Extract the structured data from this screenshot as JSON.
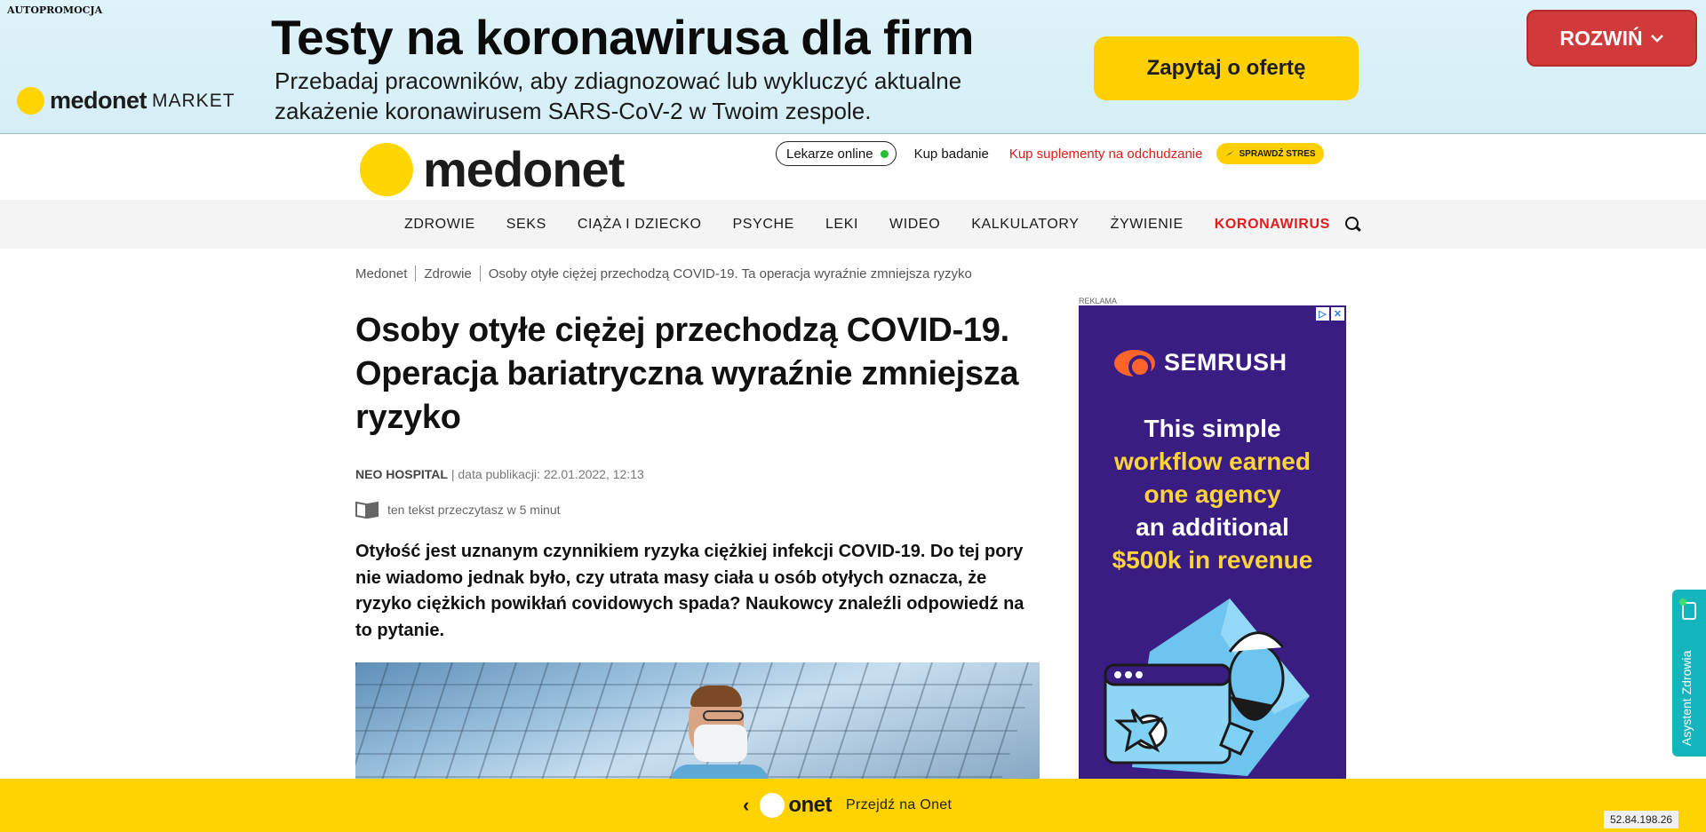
{
  "promo": {
    "tag": "AUTOPROMOCJA",
    "brand_bold": "medonet",
    "brand_light": "MARKET",
    "title": "Testy na koronawirusa dla firm",
    "subtitle_line1": "Przebadaj pracowników, aby zdiagnozować lub wykluczyć aktualne",
    "subtitle_line2": "zakażenie koronawirusem SARS-CoV-2 w Twoim zespole.",
    "cta": "Zapytaj o ofertę",
    "expand": "ROZWIŃ",
    "colors": {
      "cta": "#ffd000",
      "expand": "#d13a3a"
    }
  },
  "header": {
    "logo": "medonet",
    "online_doctors": "Lekarze online",
    "buy_test": "Kup badanie",
    "buy_supplements": "Kup suplementy na odchudzanie",
    "stress_badge": "SPRAWDŹ STRES"
  },
  "nav": {
    "items": [
      "ZDROWIE",
      "SEKS",
      "CIĄŻA I DZIECKO",
      "PSYCHE",
      "LEKI",
      "WIDEO",
      "KALKULATORY",
      "ŻYWIENIE"
    ],
    "highlight": "KORONAWIRUS",
    "search_icon": "search-icon"
  },
  "breadcrumb": [
    "Medonet",
    "Zdrowie",
    "Osoby otyłe ciężej przechodzą COVID-19. Ta operacja wyraźnie zmniejsza ryzyko"
  ],
  "article": {
    "title": "Osoby otyłe ciężej przechodzą COVID-19. Operacja bariatryczna wyraźnie zmniejsza ryzyko",
    "author": "NEO HOSPITAL",
    "date": "| data publikacji: 22.01.2022, 12:13",
    "read_time": "ten tekst przeczytasz w 5 minut",
    "lead": "Otyłość jest uznanym czynnikiem ryzyka ciężkiej infekcji COVID-19. Do tej pory nie wiadomo jednak było, czy utrata masy ciała u osób otyłych oznacza, że ryzyko ciężkich powikłań covidowych spada? Naukowcy znaleźli odpowiedź na to pytanie."
  },
  "ad": {
    "label": "REKLAMA",
    "brand": "SEMRUSH",
    "line1": "This simple",
    "line2": "workflow earned",
    "line3": "one agency",
    "line4": "an additional",
    "line5": "$500k in revenue"
  },
  "side_tab": {
    "label": "Asystent Zdrowia"
  },
  "bottom": {
    "brand": "onet",
    "go": "Przejdź na Onet"
  },
  "ip": "52.84.198.26"
}
